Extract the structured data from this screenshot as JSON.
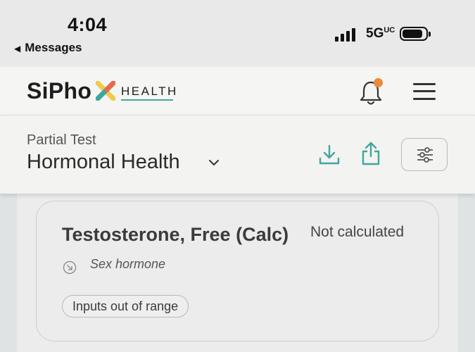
{
  "status_bar": {
    "time": "4:04",
    "back_label": "Messages",
    "network": "5G",
    "network_suffix": "UC"
  },
  "header": {
    "logo_text": "SiPho",
    "logo_sub": "HEALTH",
    "notification_badge": true,
    "icons": [
      "bell-icon",
      "hamburger-menu-icon"
    ]
  },
  "test": {
    "subtitle": "Partial Test",
    "title": "Hormonal Health",
    "actions": [
      "download-icon",
      "share-icon",
      "filter-sliders-icon"
    ]
  },
  "card": {
    "name": "Testosterone, Free (Calc)",
    "status": "Not calculated",
    "category": "Sex hormone",
    "badge": "Inputs out of range"
  },
  "colors": {
    "accent": "#3fa79d",
    "notification": "#ea8a3a",
    "logo_x_yellow": "#f2c94c",
    "logo_x_red": "#e86a4c",
    "logo_x_teal": "#3fa79d"
  }
}
